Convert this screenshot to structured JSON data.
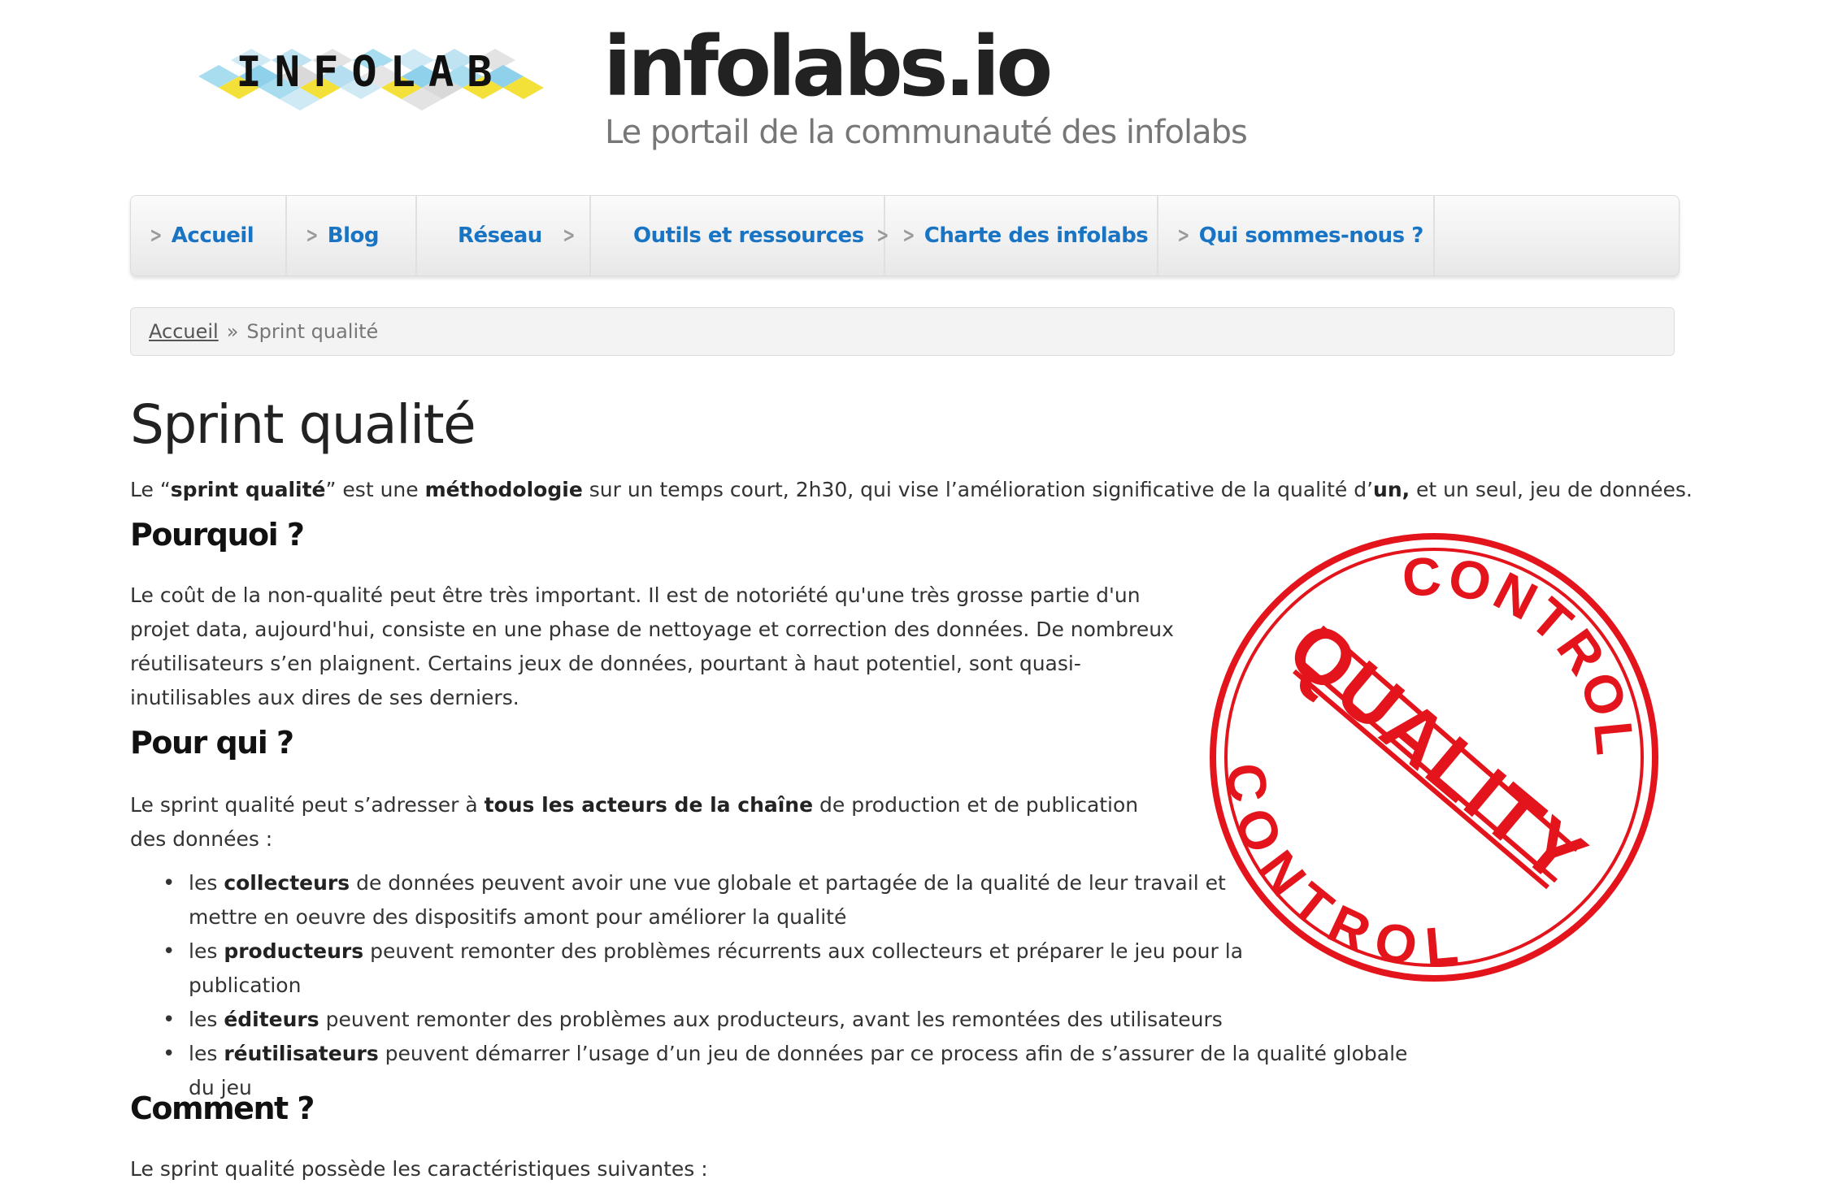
{
  "header": {
    "logo_text": "INFOLAB",
    "site_title": "infolabs.io",
    "tagline": "Le portail de la communauté des infolabs"
  },
  "nav": {
    "items": [
      {
        "label": "Accueil"
      },
      {
        "label": "Blog"
      },
      {
        "label": "Réseau"
      },
      {
        "label": "Outils et ressources"
      },
      {
        "label": "Charte des infolabs"
      },
      {
        "label": "Qui sommes-nous ?"
      }
    ]
  },
  "breadcrumb": {
    "home": "Accueil",
    "separator": "»",
    "current": "Sprint qualité"
  },
  "content": {
    "title": "Sprint qualité",
    "intro": {
      "t1": "Le “",
      "b1": "sprint qualité",
      "t2": "” est une ",
      "b2": "méthodologie",
      "t3": " sur un temps court, 2h30, qui vise l’amélioration significative de la qualité d’",
      "b3": "un,",
      "t4": " et un seul, jeu de données."
    },
    "h_pourquoi": "Pourquoi ?",
    "p_pourquoi": "Le coût de la non-qualité peut être très important. Il est de notoriété qu'une très grosse partie d'un projet data, aujourd'hui, consiste en une phase de nettoyage et correction des données. De nombreux réutilisateurs s’en plaignent. Certains jeux de données, pourtant à haut potentiel, sont quasi-inutilisables aux dires de ses derniers.",
    "h_pourqui": "Pour qui ?",
    "p_pourqui": {
      "t1": "Le sprint qualité peut s’adresser à ",
      "b1": "tous les acteurs de la chaîne",
      "t2": " de production et de publication des données :"
    },
    "bullets": [
      {
        "pre": "les ",
        "bold": "collecteurs",
        "post": " de données peuvent avoir une vue globale et partagée de la qualité de leur travail et mettre en oeuvre des dispositifs amont pour améliorer la qualité"
      },
      {
        "pre": "les ",
        "bold": "producteurs",
        "post": " peuvent remonter des problèmes récurrents aux collecteurs et préparer le jeu pour la publication"
      },
      {
        "pre": "les ",
        "bold": "éditeurs",
        "post": " peuvent remonter des problèmes aux producteurs, avant les remontées des utilisateurs"
      },
      {
        "pre": "les ",
        "bold": "réutilisateurs",
        "post": " peuvent démarrer l’usage d’un jeu de données par ce process afin de s’assurer de la qualité globale du jeu"
      }
    ],
    "h_comment": "Comment ?",
    "p_comment": "Le sprint qualité possède les caractéristiques suivantes :"
  },
  "stamp": {
    "top": "CONTROL",
    "middle": "QUALITY",
    "bottom": "CONTROL",
    "color": "#e3141b"
  }
}
